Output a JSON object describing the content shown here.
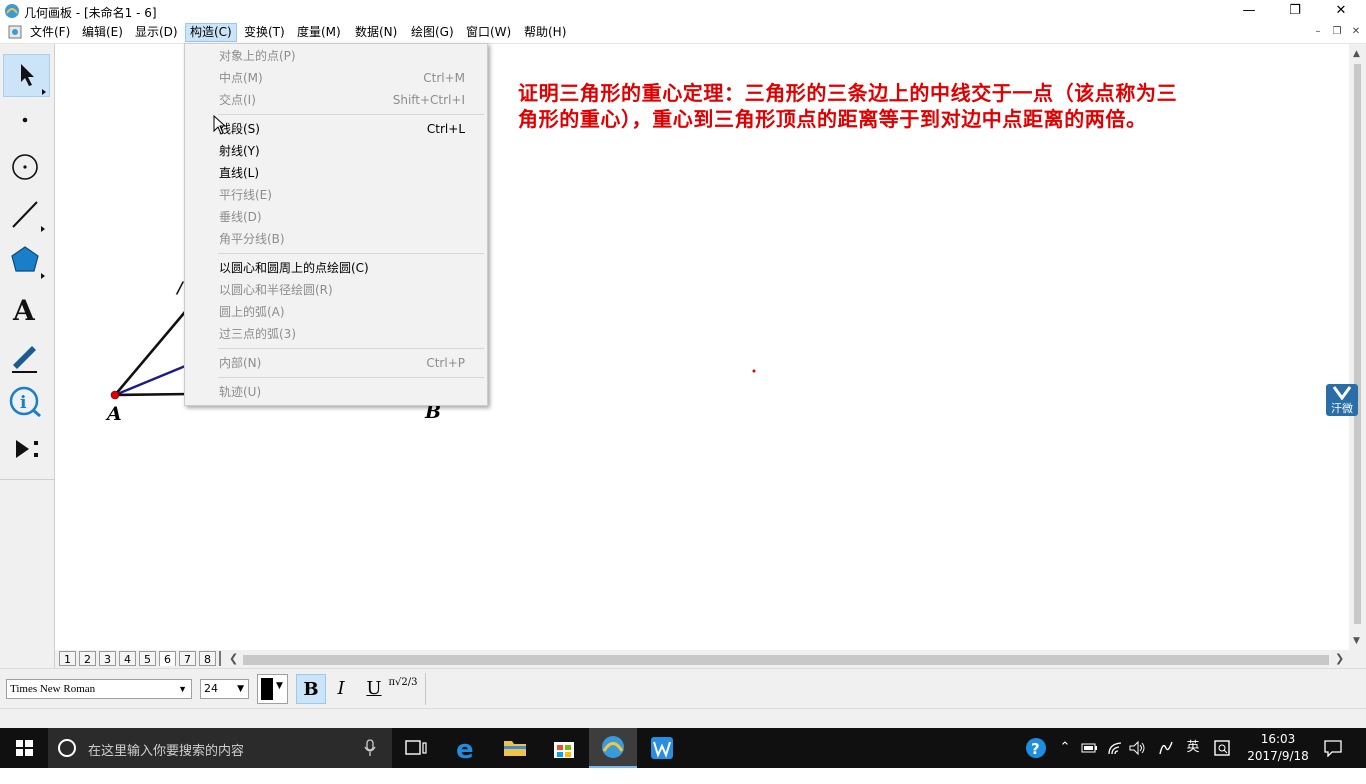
{
  "app": {
    "title": "几何画板 - [未命名1 - 6]"
  },
  "menubar": {
    "items": [
      "文件(F)",
      "编辑(E)",
      "显示(D)",
      "构造(C)",
      "变换(T)",
      "度量(M)",
      "数据(N)",
      "绘图(G)",
      "窗口(W)",
      "帮助(H)"
    ],
    "active": "构造(C)"
  },
  "construct_menu": {
    "items": [
      {
        "label": "对象上的点(P)",
        "shortcut": "",
        "enabled": false
      },
      {
        "label": "中点(M)",
        "shortcut": "Ctrl+M",
        "enabled": false
      },
      {
        "label": "交点(I)",
        "shortcut": "Shift+Ctrl+I",
        "enabled": false
      },
      {
        "label": "线段(S)",
        "shortcut": "Ctrl+L",
        "enabled": true
      },
      {
        "label": "射线(Y)",
        "shortcut": "",
        "enabled": true
      },
      {
        "label": "直线(L)",
        "shortcut": "",
        "enabled": true
      },
      {
        "label": "平行线(E)",
        "shortcut": "",
        "enabled": false
      },
      {
        "label": "垂线(D)",
        "shortcut": "",
        "enabled": false
      },
      {
        "label": "角平分线(B)",
        "shortcut": "",
        "enabled": false
      },
      {
        "label": "以圆心和圆周上的点绘圆(C)",
        "shortcut": "",
        "enabled": true
      },
      {
        "label": "以圆心和半径绘圆(R)",
        "shortcut": "",
        "enabled": false
      },
      {
        "label": "圆上的弧(A)",
        "shortcut": "",
        "enabled": false
      },
      {
        "label": "过三点的弧(3)",
        "shortcut": "",
        "enabled": false
      },
      {
        "label": "内部(N)",
        "shortcut": "Ctrl+P",
        "enabled": false
      },
      {
        "label": "轨迹(U)",
        "shortcut": "",
        "enabled": false
      }
    ]
  },
  "canvas": {
    "theorem_text": "证明三角形的重心定理：三角形的三条边上的中线交于一点（该点称为三角形的重心），重心到三角形顶点的距离等于到对边中点距离的两倍。",
    "point_labels": {
      "a": "A",
      "b": "B"
    }
  },
  "page_tabs": [
    "1",
    "2",
    "3",
    "4",
    "5",
    "6",
    "7",
    "8"
  ],
  "active_page": "6",
  "format": {
    "font": "Times New Roman",
    "size": "24",
    "bold": "B",
    "italic": "I",
    "underline": "U",
    "symbol": "π√2/3"
  },
  "taskbar": {
    "search_placeholder": "在这里输入你要搜索的内容",
    "ime": "英",
    "time": "16:03",
    "date": "2017/9/18"
  },
  "side_logo": {
    "text": "汗微"
  },
  "colors": {
    "accent": "#cce4f7",
    "theorem": "#e00000",
    "taskbar": "#101010"
  }
}
